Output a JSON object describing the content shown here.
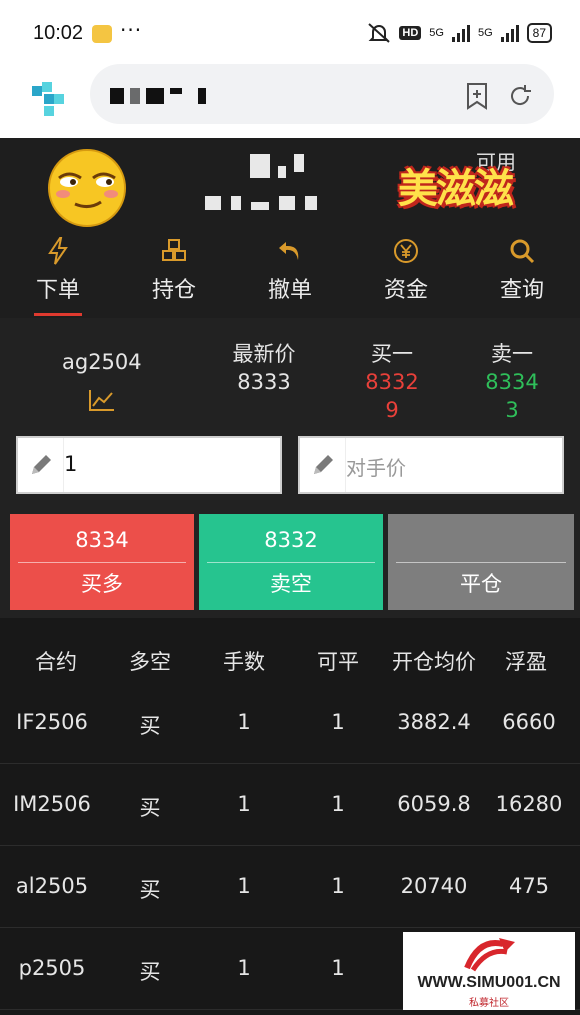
{
  "status_bar": {
    "time": "10:02",
    "battery": "87",
    "network": "5G",
    "hd": "HD"
  },
  "tabs": [
    {
      "label": "下单",
      "icon": "lightning-icon",
      "active": true
    },
    {
      "label": "持仓",
      "icon": "boxes-icon",
      "active": false
    },
    {
      "label": "撤单",
      "icon": "undo-icon",
      "active": false
    },
    {
      "label": "资金",
      "icon": "yen-coin-icon",
      "active": false
    },
    {
      "label": "查询",
      "icon": "search-icon",
      "active": false
    }
  ],
  "account": {
    "available_label": "可用",
    "sticker_text": "美滋滋"
  },
  "quote": {
    "contract": "ag2504",
    "last_label": "最新价",
    "last_price": "8333",
    "bid_label": "买一",
    "bid_price": "8332",
    "bid_volume": "9",
    "ask_label": "卖一",
    "ask_price": "8334",
    "ask_volume": "3"
  },
  "order": {
    "quantity": "1",
    "price_placeholder": "对手价"
  },
  "actions": {
    "buy": {
      "price": "8334",
      "label": "买多"
    },
    "sell": {
      "price": "8332",
      "label": "卖空"
    },
    "close": {
      "price": "",
      "label": "平仓"
    }
  },
  "positions": {
    "headers": [
      "合约",
      "多空",
      "手数",
      "可平",
      "开仓均价",
      "浮盈"
    ],
    "rows": [
      {
        "contract": "IF2506",
        "side": "买",
        "lots": "1",
        "closable": "1",
        "avg_price": "3882.4",
        "pnl": "6660"
      },
      {
        "contract": "IM2506",
        "side": "买",
        "lots": "1",
        "closable": "1",
        "avg_price": "6059.8",
        "pnl": "16280"
      },
      {
        "contract": "al2505",
        "side": "买",
        "lots": "1",
        "closable": "1",
        "avg_price": "20740",
        "pnl": "475"
      },
      {
        "contract": "p2505",
        "side": "买",
        "lots": "1",
        "closable": "1",
        "avg_price": "",
        "pnl": ""
      }
    ]
  },
  "watermark": {
    "site": "WWW.SIMU001.CN",
    "sub": "私募社区"
  },
  "colors": {
    "accent_red": "#e8403a",
    "accent_green": "#2fbf5a",
    "tab_icon": "#d99a2b",
    "buy_button": "#ec4f4a",
    "sell_button": "#26c48f",
    "close_button": "#7e7e7e"
  }
}
